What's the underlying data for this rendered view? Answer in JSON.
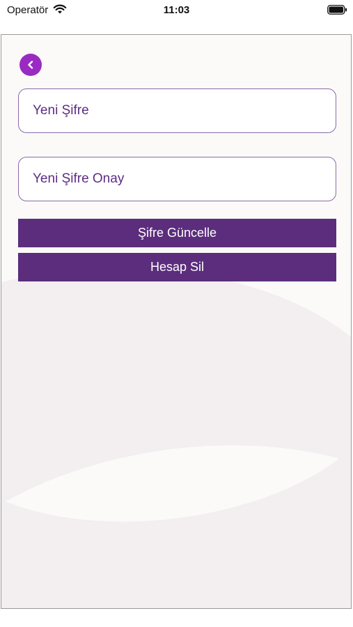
{
  "status_bar": {
    "carrier": "Operatör",
    "time": "11:03"
  },
  "icons": {
    "wifi": "wifi-icon",
    "battery": "battery-icon",
    "back": "chevron-left-icon"
  },
  "form": {
    "new_password_placeholder": "Yeni Şifre",
    "confirm_password_placeholder": "Yeni Şifre Onay"
  },
  "actions": {
    "update_password_label": "Şifre Güncelle",
    "delete_account_label": "Hesap Sil"
  },
  "colors": {
    "primary": "#5b2d7c",
    "accent": "#9a2bc2",
    "field_border": "#8a6aa8",
    "background": "#fbfaf9",
    "shape": "#f3eef0"
  }
}
